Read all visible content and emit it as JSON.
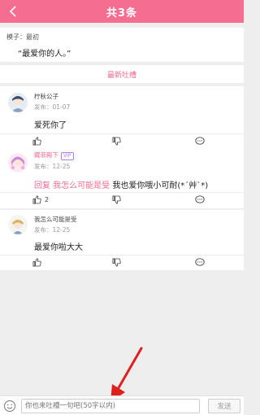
{
  "header": {
    "title": "共3条"
  },
  "quote": {
    "meta": "模子：最初",
    "text": "“最爱你的人。”"
  },
  "latest_label": "最新吐槽",
  "comments": [
    {
      "user": "柠秋公子",
      "date": "发布：01-07",
      "text": "爱死你了",
      "likes": "",
      "vip": ""
    },
    {
      "user": "藏菲殿下",
      "vip": "VIP",
      "date": "发布：12-25",
      "reply_prefix": "回复 我怎么可能是受",
      "text": "我也爱你哦小可耐(*´艸`*)",
      "likes": "2"
    },
    {
      "user": "我怎么可能是受",
      "date": "发布：12-25",
      "text": "最爱你啦大大",
      "likes": "",
      "vip": ""
    }
  ],
  "input": {
    "placeholder": "你也来吐槽一句吧(50字以内)"
  },
  "send_label": "发送",
  "colors": {
    "accent": "#f56d90",
    "vip": "#b37cf0"
  }
}
